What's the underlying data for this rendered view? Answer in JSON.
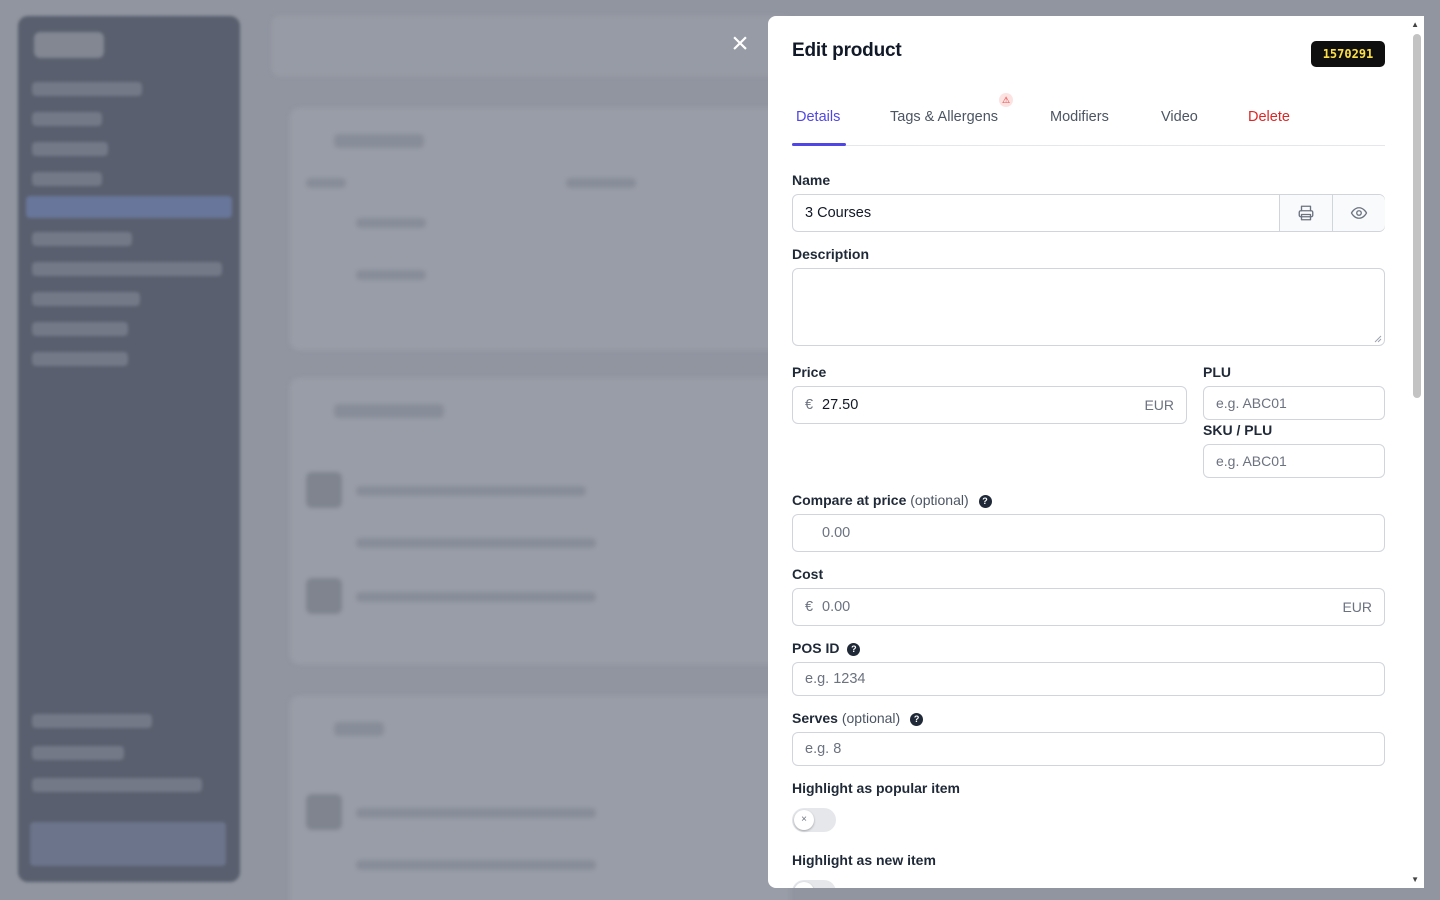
{
  "drawer": {
    "title": "Edit product",
    "product_id": "1570291",
    "close_icon": "close-icon"
  },
  "tabs": [
    {
      "label": "Details",
      "active": true
    },
    {
      "label": "Tags & Allergens",
      "warning": true
    },
    {
      "label": "Modifiers"
    },
    {
      "label": "Video"
    },
    {
      "label": "Delete",
      "color": "#dc2626"
    }
  ],
  "form": {
    "name_label": "Name",
    "name_value": "3 Courses",
    "description_label": "Description",
    "description_value": "",
    "price_label": "Price",
    "price_currency_symbol": "€",
    "price_value": "27.50",
    "price_currency": "EUR",
    "plu_label": "PLU",
    "plu_placeholder": "e.g. ABC01",
    "sku_label": "SKU / PLU",
    "sku_placeholder": "e.g. ABC01",
    "compare_label": "Compare at price",
    "compare_optional": "(optional)",
    "compare_placeholder": "0.00",
    "cost_label": "Cost",
    "cost_currency_symbol": "€",
    "cost_placeholder": "0.00",
    "cost_currency": "EUR",
    "pos_label": "POS ID",
    "pos_placeholder": "e.g. 1234",
    "serves_label": "Serves",
    "serves_optional": "(optional)",
    "serves_placeholder": "e.g. 8",
    "popular_label": "Highlight as popular item",
    "popular_on": false,
    "new_label": "Highlight as new item",
    "new_on": false
  },
  "colors": {
    "accent": "#4f46e5",
    "danger": "#dc2626",
    "badge_bg": "#0f0f0f",
    "badge_text": "#fde047"
  }
}
